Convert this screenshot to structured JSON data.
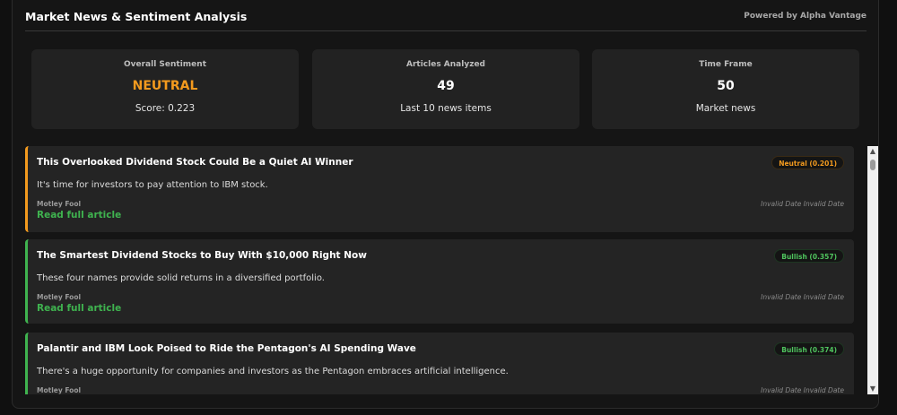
{
  "header": {
    "title": "Market News & Sentiment Analysis",
    "powered_by": "Powered by Alpha Vantage"
  },
  "stats": {
    "overall": {
      "label": "Overall Sentiment",
      "value": "NEUTRAL",
      "sub": "Score: 0.223"
    },
    "articles": {
      "label": "Articles Analyzed",
      "value": "49",
      "sub": "Last 10 news items"
    },
    "timeframe": {
      "label": "Time Frame",
      "value": "50",
      "sub": "Market news"
    }
  },
  "articles": [
    {
      "title": "This Overlooked Dividend Stock Could Be a Quiet AI Winner",
      "summary": "It's time for investors to pay attention to IBM stock.",
      "source": "Motley Fool",
      "date": "Invalid Date Invalid Date",
      "sentiment": "Neutral (0.201)",
      "link": "Read full article"
    },
    {
      "title": "The Smartest Dividend Stocks to Buy With $10,000 Right Now",
      "summary": "These four names provide solid returns in a diversified portfolio.",
      "source": "Motley Fool",
      "date": "Invalid Date Invalid Date",
      "sentiment": "Bullish (0.357)",
      "link": "Read full article"
    },
    {
      "title": "Palantir and IBM Look Poised to Ride the Pentagon's AI Spending Wave",
      "summary": "There's a huge opportunity for companies and investors as the Pentagon embraces artificial intelligence.",
      "source": "Motley Fool",
      "date": "Invalid Date Invalid Date",
      "sentiment": "Bullish (0.374)"
    }
  ],
  "colors": {
    "neutral": "#f39a1e",
    "bullish": "#3fb34f"
  },
  "scrollbar": {
    "up_icon": "triangle-up-icon",
    "down_icon": "triangle-down-icon"
  }
}
